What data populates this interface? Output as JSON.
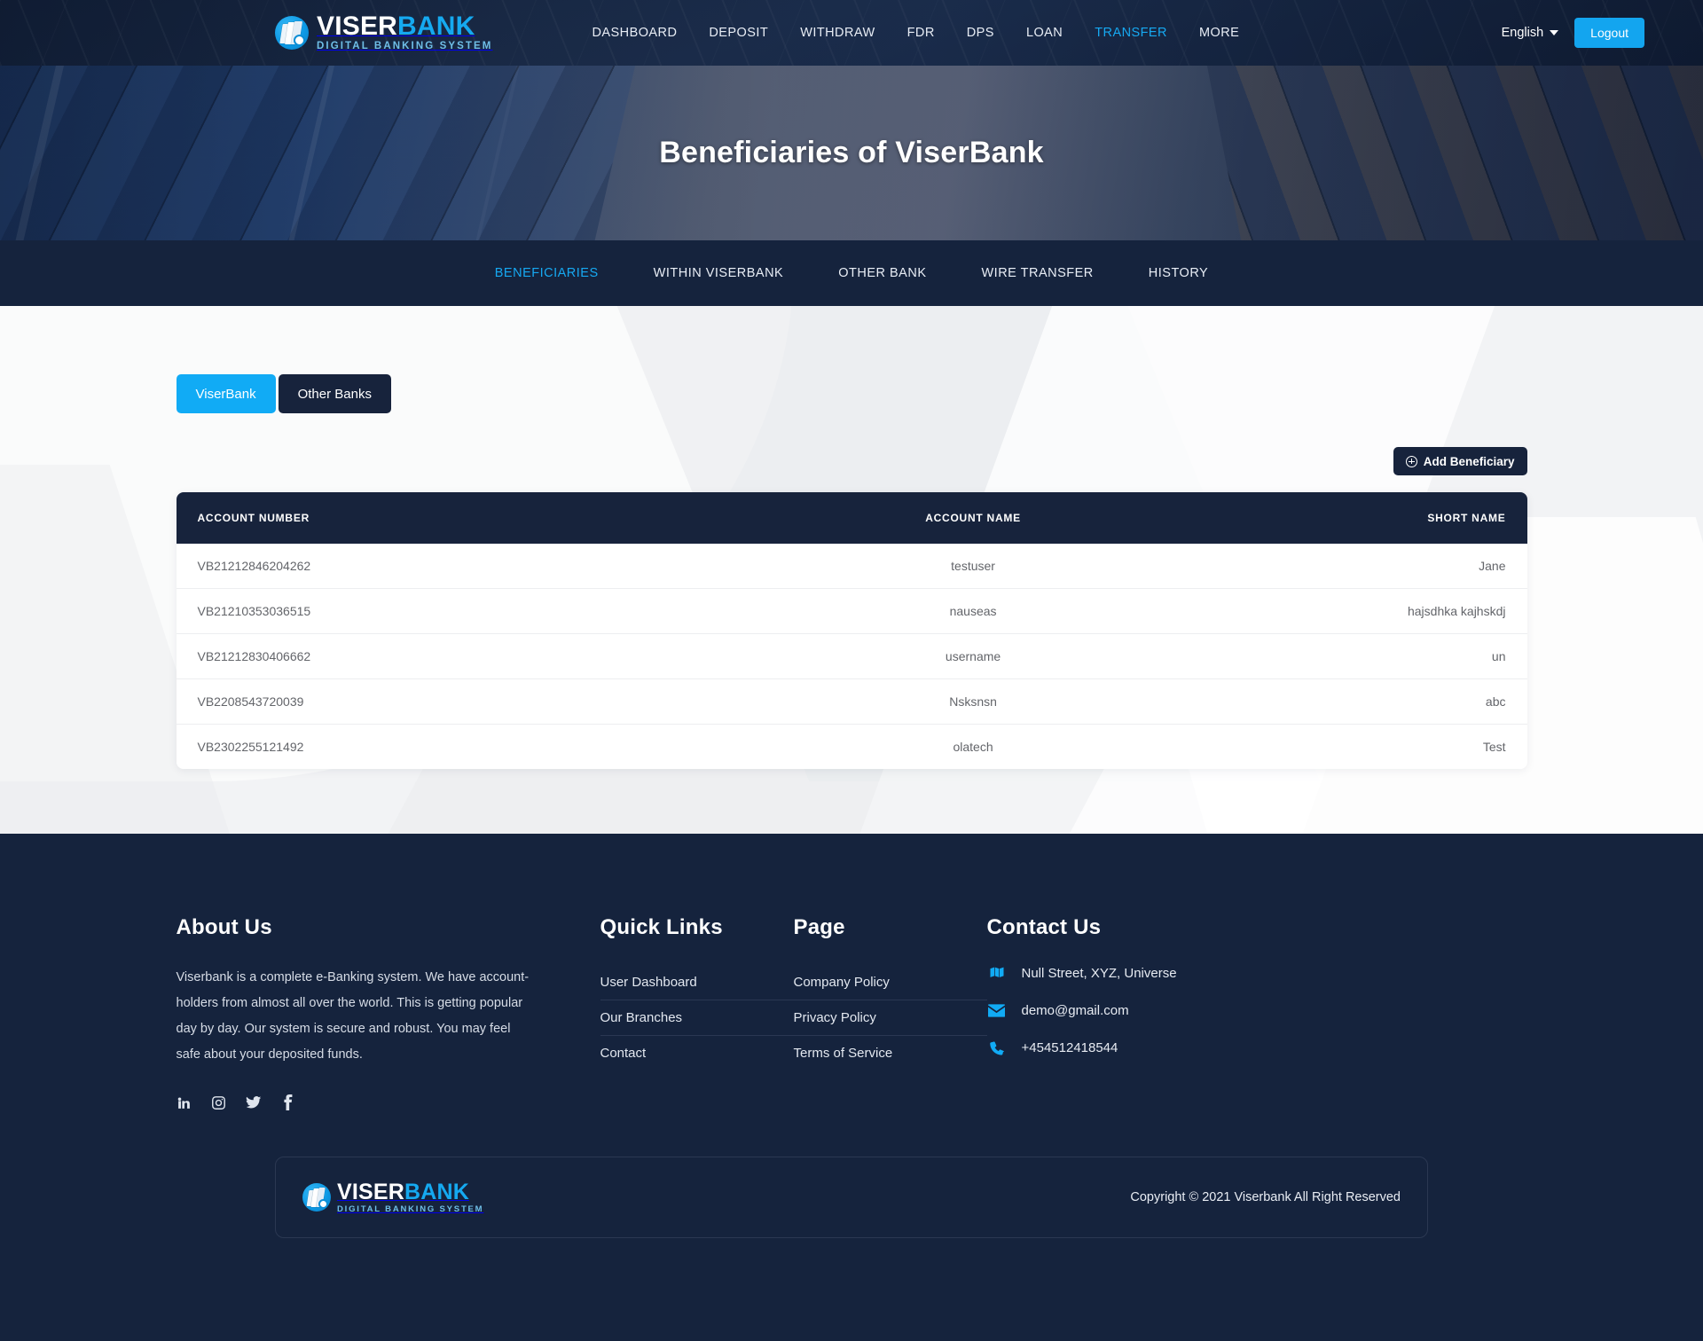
{
  "brand": {
    "name_part1": "VISER",
    "name_part2": "BANK",
    "tagline": "DIGITAL BANKING SYSTEM"
  },
  "header": {
    "nav": [
      {
        "label": "DASHBOARD",
        "active": false
      },
      {
        "label": "DEPOSIT",
        "active": false
      },
      {
        "label": "WITHDRAW",
        "active": false
      },
      {
        "label": "FDR",
        "active": false
      },
      {
        "label": "DPS",
        "active": false
      },
      {
        "label": "LOAN",
        "active": false
      },
      {
        "label": "TRANSFER",
        "active": true
      },
      {
        "label": "MORE",
        "active": false
      }
    ],
    "language": "English",
    "logout_label": "Logout"
  },
  "hero": {
    "title": "Beneficiaries of ViserBank"
  },
  "subnav": [
    {
      "label": "BENEFICIARIES",
      "active": true
    },
    {
      "label": "WITHIN VISERBANK",
      "active": false
    },
    {
      "label": "OTHER BANK",
      "active": false
    },
    {
      "label": "WIRE TRANSFER",
      "active": false
    },
    {
      "label": "HISTORY",
      "active": false
    }
  ],
  "main": {
    "tabs": [
      {
        "label": "ViserBank",
        "active": true
      },
      {
        "label": "Other Banks",
        "active": false
      }
    ],
    "add_button_label": "Add Beneficiary",
    "table": {
      "columns": [
        "ACCOUNT NUMBER",
        "ACCOUNT NAME",
        "SHORT NAME"
      ],
      "rows": [
        {
          "account_number": "VB21212846204262",
          "account_name": "testuser",
          "short_name": "Jane"
        },
        {
          "account_number": "VB21210353036515",
          "account_name": "nauseas",
          "short_name": "hajsdhka kajhskdj"
        },
        {
          "account_number": "VB21212830406662",
          "account_name": "username",
          "short_name": "un"
        },
        {
          "account_number": "VB2208543720039",
          "account_name": "Nsksnsn",
          "short_name": "abc"
        },
        {
          "account_number": "VB2302255121492",
          "account_name": "olatech",
          "short_name": "Test"
        }
      ]
    }
  },
  "footer": {
    "about": {
      "title": "About Us",
      "text": "Viserbank is a complete e-Banking system. We have account-holders from almost all over the world. This is getting popular day by day. Our system is secure and robust. You may feel safe about your deposited funds."
    },
    "quick_links": {
      "title": "Quick Links",
      "items": [
        "User Dashboard",
        "Our Branches",
        "Contact"
      ]
    },
    "page": {
      "title": "Page",
      "items": [
        "Company Policy",
        "Privacy Policy",
        "Terms of Service"
      ]
    },
    "contact": {
      "title": "Contact Us",
      "address": "Null Street, XYZ, Universe",
      "email": "demo@gmail.com",
      "phone": "+454512418544"
    },
    "socials": [
      "linkedin-icon",
      "instagram-icon",
      "twitter-icon",
      "facebook-icon"
    ],
    "copyright": "Copyright © 2021 Viserbank All Right Reserved"
  },
  "colors": {
    "accent": "#11abf5",
    "dark": "#15233d",
    "panel": "#17233c"
  }
}
